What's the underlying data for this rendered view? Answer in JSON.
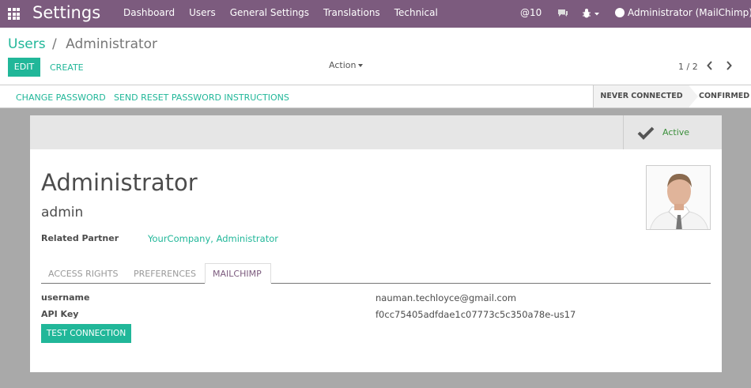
{
  "navbar": {
    "brand": "Settings",
    "menu": [
      "Dashboard",
      "Users",
      "General Settings",
      "Translations",
      "Technical"
    ],
    "messages_label": "@10",
    "user_label": "Administrator (MailChimp)",
    "bg_color": "#7c5b7e"
  },
  "breadcrumb": {
    "parent": "Users",
    "separator": "/",
    "current": "Administrator"
  },
  "buttons": {
    "edit": "EDIT",
    "create": "CREATE",
    "action": "Action"
  },
  "pager": {
    "text": "1 / 2"
  },
  "statusbar": {
    "change_password": "CHANGE PASSWORD",
    "send_reset": "SEND RESET PASSWORD INSTRUCTIONS",
    "states": [
      "NEVER CONNECTED",
      "CONFIRMED"
    ]
  },
  "form": {
    "active_label": "Active",
    "name": "Administrator",
    "login": "admin",
    "related_partner_label": "Related Partner",
    "related_partner_value": "YourCompany, Administrator",
    "tabs": [
      "ACCESS RIGHTS",
      "PREFERENCES",
      "MAILCHIMP"
    ],
    "active_tab": "MAILCHIMP",
    "username_label": "username",
    "username_value": "nauman.techloyce@gmail.com",
    "api_key_label": "API Key",
    "api_key_value": "f0cc75405adfdae1c07773c5c350a78e-us17",
    "test_button": "TEST CONNECTION"
  },
  "colors": {
    "accent": "#21b799",
    "brand": "#7c5b7e",
    "active_green": "#3b8f3b"
  }
}
